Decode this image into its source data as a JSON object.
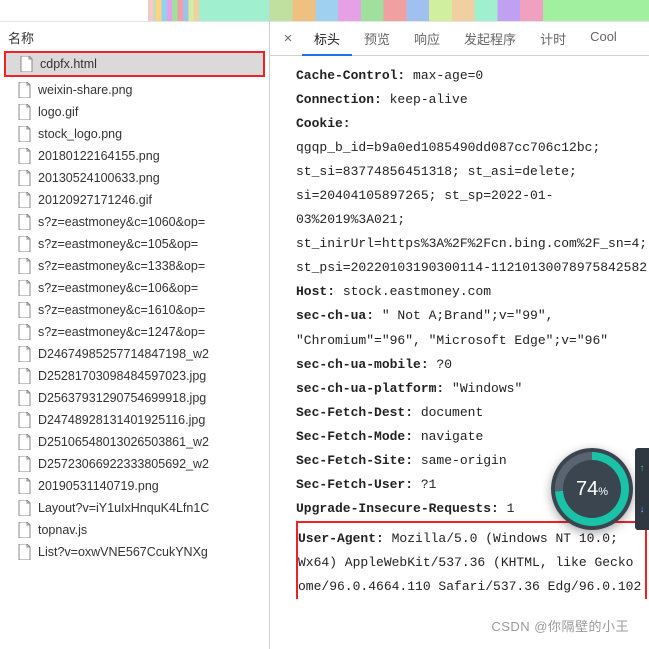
{
  "left": {
    "header": "名称",
    "files": [
      {
        "name": "cdpfx.html",
        "icon": "doc",
        "selected": true
      },
      {
        "name": "weixin-share.png",
        "icon": "doc"
      },
      {
        "name": "logo.gif",
        "icon": "doc"
      },
      {
        "name": "stock_logo.png",
        "icon": "doc"
      },
      {
        "name": "20180122164155.png",
        "icon": "doc"
      },
      {
        "name": "20130524100633.png",
        "icon": "doc"
      },
      {
        "name": "20120927171246.gif",
        "icon": "doc"
      },
      {
        "name": "s?z=eastmoney&c=1060&op=",
        "icon": "doc"
      },
      {
        "name": "s?z=eastmoney&c=105&op=",
        "icon": "doc"
      },
      {
        "name": "s?z=eastmoney&c=1338&op=",
        "icon": "doc"
      },
      {
        "name": "s?z=eastmoney&c=106&op=",
        "icon": "doc"
      },
      {
        "name": "s?z=eastmoney&c=1610&op=",
        "icon": "doc"
      },
      {
        "name": "s?z=eastmoney&c=1247&op=",
        "icon": "doc"
      },
      {
        "name": "D24674985257714847198_w2",
        "icon": "doc"
      },
      {
        "name": "D25281703098484597023.jpg",
        "icon": "doc"
      },
      {
        "name": "D25637931290754699918.jpg",
        "icon": "doc"
      },
      {
        "name": "D24748928131401925116.jpg",
        "icon": "doc"
      },
      {
        "name": "D25106548013026503861_w2",
        "icon": "doc"
      },
      {
        "name": "D25723066922333805692_w2",
        "icon": "doc"
      },
      {
        "name": "20190531140719.png",
        "icon": "doc"
      },
      {
        "name": "Layout?v=iY1uIxHnquK4Lfn1C",
        "icon": "doc"
      },
      {
        "name": "topnav.js",
        "icon": "doc"
      },
      {
        "name": "List?v=oxwVNE567CcukYNXg",
        "icon": "doc"
      }
    ]
  },
  "tabs": {
    "close_glyph": "×",
    "items": [
      {
        "label": "标头",
        "active": true
      },
      {
        "label": "预览"
      },
      {
        "label": "响应"
      },
      {
        "label": "发起程序"
      },
      {
        "label": "计时"
      },
      {
        "label": "Cool"
      }
    ]
  },
  "headers": [
    {
      "k": "Cache-Control:",
      "v": " max-age=0"
    },
    {
      "k": "Connection:",
      "v": " keep-alive"
    },
    {
      "k": "Cookie:",
      "v": " qgqp_b_id=b9a0ed1085490dd087cc706c12bc; st_si=83774856451318; st_asi=delete; si=20404105897265; st_sp=2022-01-03%2019%3A021; st_inirUrl=https%3A%2F%2Fcn.bing.com%2F_sn=4; st_psi=20220103190300114-11210130078975842582"
    },
    {
      "k": "Host:",
      "v": " stock.eastmoney.com"
    },
    {
      "k": "sec-ch-ua:",
      "v": " \" Not A;Brand\";v=\"99\", \"Chromium\"=\"96\", \"Microsoft Edge\";v=\"96\""
    },
    {
      "k": "sec-ch-ua-mobile:",
      "v": " ?0"
    },
    {
      "k": "sec-ch-ua-platform:",
      "v": " \"Windows\""
    },
    {
      "k": "Sec-Fetch-Dest:",
      "v": " document"
    },
    {
      "k": "Sec-Fetch-Mode:",
      "v": " navigate"
    },
    {
      "k": "Sec-Fetch-Site:",
      "v": " same-origin"
    },
    {
      "k": "Sec-Fetch-User:",
      "v": " ?1"
    },
    {
      "k": "Upgrade-Insecure-Requests:",
      "v": " 1"
    }
  ],
  "user_agent": {
    "k": "User-Agent:",
    "v": " Mozilla/5.0 (Windows NT 10.0; Wx64) AppleWebKit/537.36 (KHTML, like Gecko ome/96.0.4664.110 Safari/537.36 Edg/96.0.102"
  },
  "gauge": {
    "value": "74",
    "suffix": "%"
  },
  "watermark": "CSDN @你隔壁的小王"
}
